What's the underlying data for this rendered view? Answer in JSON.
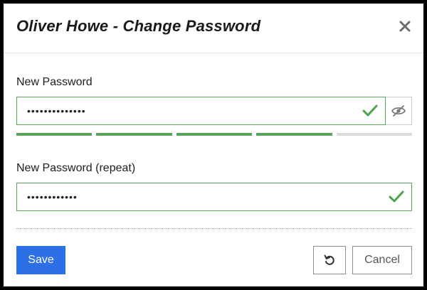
{
  "dialog": {
    "title": "Oliver Howe - Change Password",
    "close_icon": "close-icon"
  },
  "fields": {
    "new_password": {
      "label": "New Password",
      "value": "••••••••••••••",
      "valid_icon": "check-icon",
      "toggle_icon": "eye-slash-icon"
    },
    "new_password_repeat": {
      "label": "New Password (repeat)",
      "value": "••••••••••••",
      "valid_icon": "check-icon"
    }
  },
  "strength_meter": {
    "filled_segments": 4,
    "total_segments": 5,
    "fill_color": "#5aa55a",
    "empty_color": "#dcdcdc"
  },
  "buttons": {
    "save_label": "Save",
    "reset_icon": "undo-icon",
    "cancel_label": "Cancel"
  },
  "colors": {
    "accent": "#2d6fe6",
    "valid": "#5aa55a"
  }
}
